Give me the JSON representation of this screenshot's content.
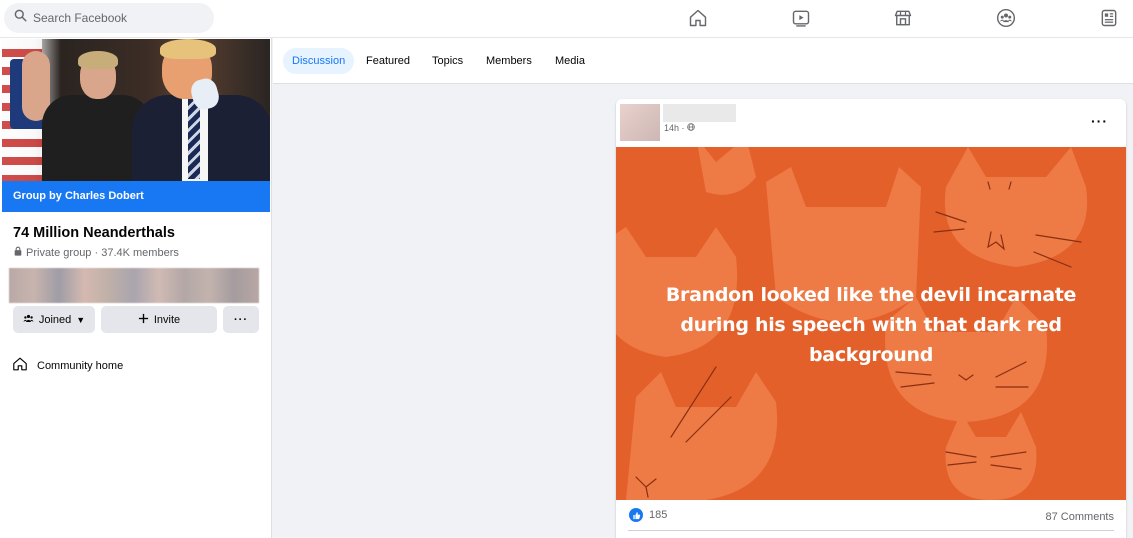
{
  "search": {
    "placeholder": "Search Facebook"
  },
  "nav": {
    "icons": [
      "home-icon",
      "watch-icon",
      "marketplace-icon",
      "groups-icon",
      "feeds-icon"
    ]
  },
  "group": {
    "owner_label": "Group by Charles Dobert",
    "name": "74 Million Neanderthals",
    "privacy": "Private group",
    "members": "37.4K members",
    "joined_label": "Joined",
    "invite_label": "Invite",
    "more_label": "···",
    "community_home": "Community home"
  },
  "tabs": [
    {
      "label": "Discussion",
      "active": true
    },
    {
      "label": "Featured",
      "active": false
    },
    {
      "label": "Topics",
      "active": false
    },
    {
      "label": "Members",
      "active": false
    },
    {
      "label": "Media",
      "active": false
    }
  ],
  "post": {
    "time": "14h ·",
    "more": "···",
    "text": "Brandon looked like the devil incarnate during his speech with that dark red background",
    "reactions_count": "185",
    "comments": "87 Comments"
  },
  "colors": {
    "accent": "#1877f2",
    "post_background": "#e4602b"
  }
}
